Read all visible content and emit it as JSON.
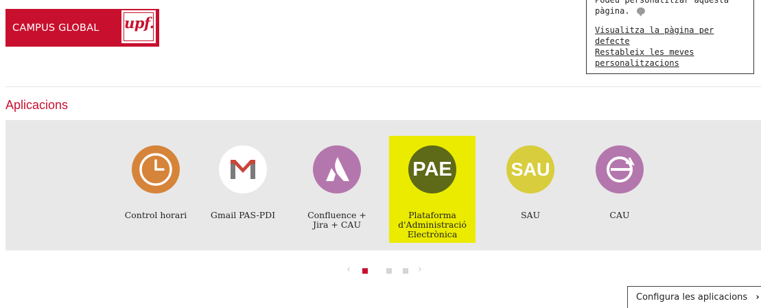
{
  "header": {
    "logo_text": "CAMPUS GLOBAL",
    "logo_mark": "upf.",
    "brand_color": "#c8102e"
  },
  "personalize": {
    "line1": "Podeu personalitzar aquesta",
    "line2": "pàgina.",
    "link_default": "Visualitza la pàgina per defecte",
    "link_reset_1": "Restableix les meves",
    "link_reset_2": "personalitzacions",
    "icon": "comment-icon"
  },
  "section": {
    "title": "Aplicacions"
  },
  "apps": [
    {
      "label": "Control horari",
      "icon": "clock-icon",
      "color": "#d6843a"
    },
    {
      "label": "Gmail PAS-PDI",
      "icon": "gmail-icon",
      "color": "#ffffff"
    },
    {
      "label_1": "Confluence +",
      "label_2": "Jira + CAU",
      "icon": "atlassian-icon",
      "color": "#b477ad"
    },
    {
      "label_1": "Plataforma",
      "label_2": "d'Administració",
      "label_3": "Electrònica",
      "icon_text": "PAE",
      "color": "#5e6a18",
      "selected": true,
      "highlight": "#ebeb00"
    },
    {
      "label": "SAU",
      "icon_text": "SAU",
      "color": "#d8cd3c"
    },
    {
      "label": "CAU",
      "icon": "cau-icon",
      "color": "#b477ad"
    }
  ],
  "pager": {
    "prev": "‹",
    "next": "›",
    "pages": 3,
    "active_page": 1
  },
  "config_button": {
    "label": "Configura les aplicacions",
    "chevron": "›"
  }
}
